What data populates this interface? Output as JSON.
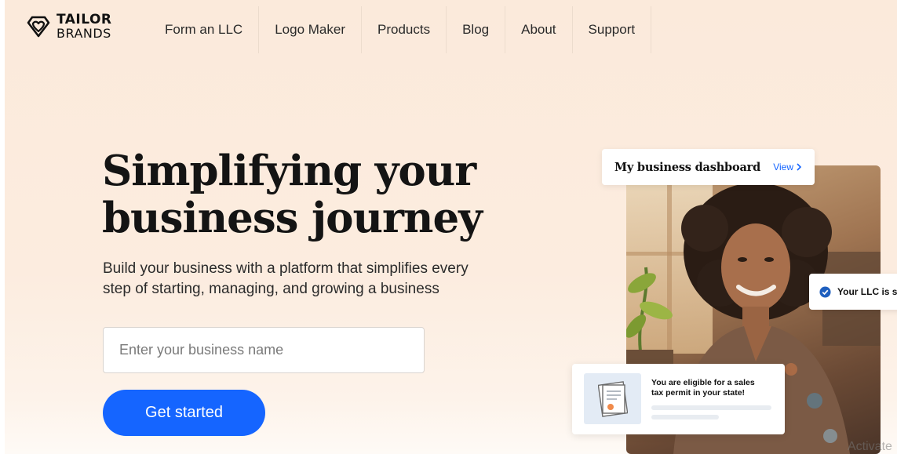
{
  "header": {
    "logo_line1": "TAILOR",
    "logo_line2": "BRANDS",
    "nav": [
      {
        "label": "Form an LLC"
      },
      {
        "label": "Logo Maker"
      },
      {
        "label": "Products"
      },
      {
        "label": "Blog"
      },
      {
        "label": "About"
      },
      {
        "label": "Support"
      }
    ]
  },
  "hero": {
    "title_line1": "Simplifying your",
    "title_line2": "business journey",
    "subtitle_line1": "Build your business with a platform that simplifies every",
    "subtitle_line2": "step of starting, managing, and growing a business",
    "input_placeholder": "Enter your business name",
    "cta_label": "Get started"
  },
  "cards": {
    "dashboard_title": "My business dashboard",
    "dashboard_link": "View",
    "llc_text": "Your LLC is su",
    "tax_line1": "You are eligible for a sales",
    "tax_line2": "tax permit in your state!"
  },
  "watermark": "Activate",
  "colors": {
    "accent": "#1565ff",
    "background": "#fbeadb",
    "check": "#1f5fbf"
  },
  "icons": [
    "tailor-brands-logo-icon",
    "chevron-right-icon",
    "check-circle-icon",
    "certificate-icon"
  ]
}
